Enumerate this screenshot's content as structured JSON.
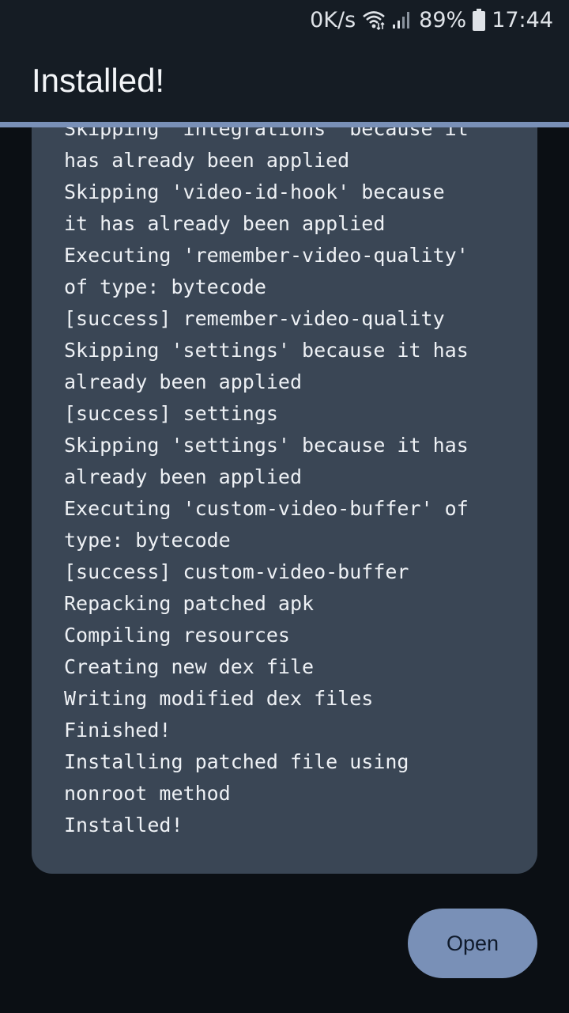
{
  "status_bar": {
    "net_speed": "0K/s",
    "battery_percent": "89%",
    "time": "17:44",
    "icons": [
      "wifi-icon",
      "signal-icon",
      "battery-icon"
    ]
  },
  "app_bar": {
    "title": "Installed!"
  },
  "progress": {
    "value": 1.0,
    "color": "#7990b7"
  },
  "log": {
    "lines": [
      "Skipping 'integrations' because it",
      "has already been applied",
      "Skipping 'video-id-hook' because",
      "it has already been applied",
      "Executing 'remember-video-quality'",
      "of type: bytecode",
      "[success] remember-video-quality",
      "Skipping 'settings' because it has",
      "already been applied",
      "[success] settings",
      "Skipping 'settings' because it has",
      "already been applied",
      "Executing 'custom-video-buffer' of",
      "type: bytecode",
      "[success] custom-video-buffer",
      "Repacking patched apk",
      "Compiling resources",
      "Creating new dex file",
      "Writing modified dex files",
      "Finished!",
      "Installing patched file using",
      "nonroot method",
      "Installed!"
    ]
  },
  "actions": {
    "open_label": "Open"
  },
  "colors": {
    "background": "#0b0f14",
    "bar": "#151c24",
    "card": "#3a4655",
    "accent": "#7990b7"
  }
}
